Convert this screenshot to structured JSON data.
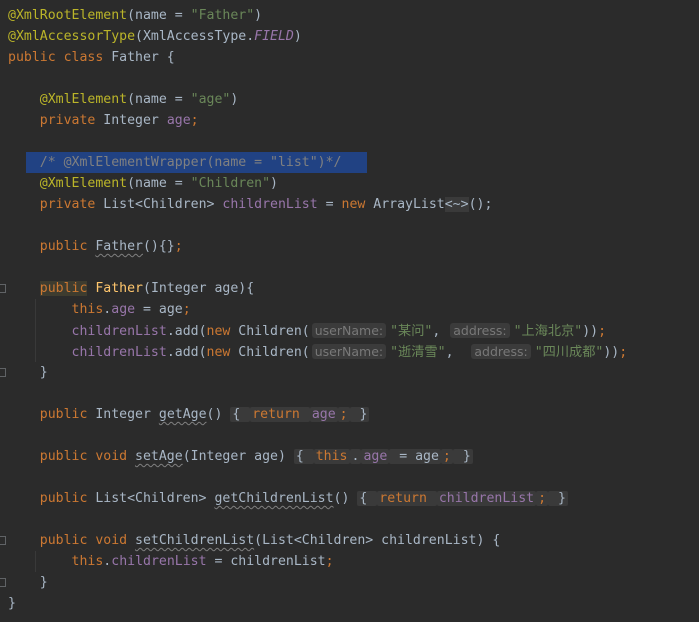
{
  "editor": {
    "lines": [
      {
        "segments": [
          {
            "t": "@XmlRootElement",
            "c": "ann"
          },
          {
            "t": "(name = "
          },
          {
            "t": "\"Father\"",
            "c": "str"
          },
          {
            "t": ")"
          }
        ]
      },
      {
        "segments": [
          {
            "t": "@XmlAccessorType",
            "c": "ann"
          },
          {
            "t": "(XmlAccessType."
          },
          {
            "t": "FIELD",
            "c": "field ital"
          },
          {
            "t": ")"
          }
        ]
      },
      {
        "segments": [
          {
            "t": "public class ",
            "c": "kw"
          },
          {
            "t": "Father {"
          }
        ]
      },
      {
        "segments": []
      },
      {
        "segments": [
          {
            "t": "    "
          },
          {
            "t": "@XmlElement",
            "c": "ann"
          },
          {
            "t": "(name = "
          },
          {
            "t": "\"age\"",
            "c": "str"
          },
          {
            "t": ")"
          }
        ]
      },
      {
        "segments": [
          {
            "t": "    "
          },
          {
            "t": "private ",
            "c": "kw"
          },
          {
            "t": "Integer "
          },
          {
            "t": "age",
            "c": "field"
          },
          {
            "t": ";",
            "c": "kw"
          }
        ]
      },
      {
        "segments": []
      },
      {
        "selected": true,
        "segments": [
          {
            "t": "    "
          },
          {
            "t": "/* @XmlElementWrapper(name = \"list\")*/",
            "c": "comment"
          }
        ]
      },
      {
        "segments": [
          {
            "t": "    "
          },
          {
            "t": "@XmlElement",
            "c": "ann"
          },
          {
            "t": "(name = "
          },
          {
            "t": "\"Children\"",
            "c": "str"
          },
          {
            "t": ")"
          }
        ]
      },
      {
        "segments": [
          {
            "t": "    "
          },
          {
            "t": "private ",
            "c": "kw"
          },
          {
            "t": "List<Children> "
          },
          {
            "t": "childrenList",
            "c": "field"
          },
          {
            "t": " = "
          },
          {
            "t": "new ",
            "c": "kw"
          },
          {
            "t": "ArrayList"
          },
          {
            "t": "<~>",
            "c": "dim-bracket"
          },
          {
            "t": "();"
          }
        ]
      },
      {
        "segments": []
      },
      {
        "segments": [
          {
            "t": "    "
          },
          {
            "t": "public ",
            "c": "kw"
          },
          {
            "t": "Father",
            "c": "squig"
          },
          {
            "t": "(){}"
          },
          {
            "t": ";",
            "c": "kw"
          }
        ]
      },
      {
        "segments": []
      },
      {
        "segments": [
          {
            "t": "    "
          },
          {
            "t": "public",
            "c": "kw mark"
          },
          {
            "t": " "
          },
          {
            "t": "Father",
            "c": "fn"
          },
          {
            "t": "(Integer age){"
          }
        ]
      },
      {
        "segments": [
          {
            "t": "        "
          },
          {
            "t": "this",
            "c": "kw"
          },
          {
            "t": "."
          },
          {
            "t": "age",
            "c": "field"
          },
          {
            "t": " = age"
          },
          {
            "t": ";",
            "c": "kw"
          }
        ]
      },
      {
        "segments": [
          {
            "t": "        "
          },
          {
            "t": "childrenList",
            "c": "field"
          },
          {
            "t": ".add("
          },
          {
            "t": "new ",
            "c": "kw"
          },
          {
            "t": "Children("
          },
          {
            "t": "userName:",
            "c": "hint"
          },
          {
            "t": "\"某问\"",
            "c": "str"
          },
          {
            "t": ", "
          },
          {
            "t": "address:",
            "c": "hint"
          },
          {
            "t": "\"上海北京\"",
            "c": "str"
          },
          {
            "t": "))"
          },
          {
            "t": ";",
            "c": "kw"
          }
        ]
      },
      {
        "segments": [
          {
            "t": "        "
          },
          {
            "t": "childrenList",
            "c": "field"
          },
          {
            "t": ".add("
          },
          {
            "t": "new ",
            "c": "kw"
          },
          {
            "t": "Children("
          },
          {
            "t": "userName:",
            "c": "hint"
          },
          {
            "t": "\"逝清雪\"",
            "c": "str"
          },
          {
            "t": ",  "
          },
          {
            "t": "address:",
            "c": "hint"
          },
          {
            "t": "\"四川成都\"",
            "c": "str"
          },
          {
            "t": "))"
          },
          {
            "t": ";",
            "c": "kw"
          }
        ]
      },
      {
        "segments": [
          {
            "t": "    }"
          }
        ]
      },
      {
        "segments": []
      },
      {
        "segments": [
          {
            "t": "    "
          },
          {
            "t": "public ",
            "c": "kw"
          },
          {
            "t": "Integer "
          },
          {
            "t": "getAge",
            "c": "squig"
          },
          {
            "t": "() "
          },
          {
            "t": "{ ",
            "c": "fold"
          },
          {
            "t": "return ",
            "c": "kw fold"
          },
          {
            "t": "age",
            "c": "field fold"
          },
          {
            "t": ";",
            "c": "kw fold"
          },
          {
            "t": " }",
            "c": "fold"
          }
        ]
      },
      {
        "segments": []
      },
      {
        "segments": [
          {
            "t": "    "
          },
          {
            "t": "public void ",
            "c": "kw"
          },
          {
            "t": "setAge",
            "c": "squig"
          },
          {
            "t": "(Integer age) "
          },
          {
            "t": "{ ",
            "c": "fold"
          },
          {
            "t": "this",
            "c": "kw fold"
          },
          {
            "t": ".",
            "c": "fold"
          },
          {
            "t": "age",
            "c": "field fold"
          },
          {
            "t": " = age",
            "c": "fold"
          },
          {
            "t": ";",
            "c": "kw fold"
          },
          {
            "t": " }",
            "c": "fold"
          }
        ]
      },
      {
        "segments": []
      },
      {
        "segments": [
          {
            "t": "    "
          },
          {
            "t": "public ",
            "c": "kw"
          },
          {
            "t": "List<Children> "
          },
          {
            "t": "getChildrenList",
            "c": "squig"
          },
          {
            "t": "() "
          },
          {
            "t": "{ ",
            "c": "fold"
          },
          {
            "t": "return ",
            "c": "kw fold"
          },
          {
            "t": "childrenList",
            "c": "field fold"
          },
          {
            "t": ";",
            "c": "kw fold"
          },
          {
            "t": " }",
            "c": "fold"
          }
        ]
      },
      {
        "segments": []
      },
      {
        "segments": [
          {
            "t": "    "
          },
          {
            "t": "public void ",
            "c": "kw"
          },
          {
            "t": "setChildrenList",
            "c": "squig"
          },
          {
            "t": "(List<Children> childrenList) {"
          }
        ]
      },
      {
        "segments": [
          {
            "t": "        "
          },
          {
            "t": "this",
            "c": "kw"
          },
          {
            "t": "."
          },
          {
            "t": "childrenList",
            "c": "field"
          },
          {
            "t": " = childrenList"
          },
          {
            "t": ";",
            "c": "kw"
          }
        ]
      },
      {
        "segments": [
          {
            "t": "    }"
          }
        ]
      },
      {
        "segments": [
          {
            "t": "}"
          }
        ]
      }
    ]
  },
  "colors": {
    "background": "#2b2b2b",
    "annotation": "#bbb529",
    "keyword": "#cc7832",
    "string": "#6a8759",
    "field": "#9876aa",
    "comment": "#808080",
    "selection": "#214283"
  }
}
